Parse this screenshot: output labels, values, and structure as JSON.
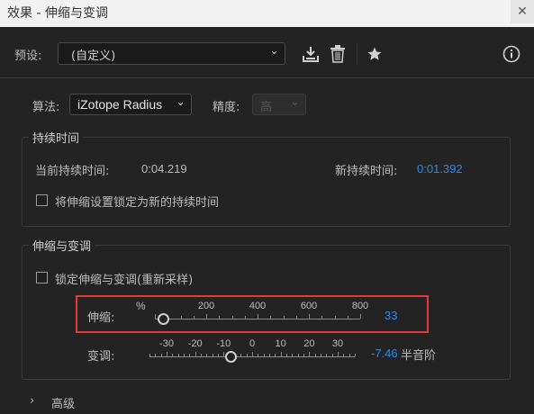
{
  "window": {
    "title": "效果 - 伸缩与变调",
    "close_icon": "close-icon"
  },
  "preset": {
    "label": "预设:",
    "value": "(自定义)"
  },
  "algorithm": {
    "label": "算法:",
    "value": "iZotope Radius",
    "precision_label": "精度:",
    "precision_value": "高"
  },
  "duration": {
    "legend": "持续时间",
    "current_label": "当前持续时间:",
    "current_value": "0:04.219",
    "new_label": "新持续时间:",
    "new_value": "0:01.392",
    "lock_label": "将伸缩设置锁定为新的持续时间"
  },
  "stretch_pitch": {
    "legend": "伸缩与变调",
    "lock_label": "锁定伸缩与变调(重新采样)",
    "stretch": {
      "label": "伸缩:",
      "unit": "%",
      "tick_labels": [
        "200",
        "400",
        "600",
        "800"
      ],
      "value": "33",
      "value_numeric": 33,
      "range": [
        0,
        800
      ]
    },
    "pitch": {
      "label": "变调:",
      "tick_labels": [
        "-30",
        "-20",
        "-10",
        "0",
        "10",
        "20",
        "30"
      ],
      "value": "-7.46",
      "unit": "半音阶",
      "value_numeric": -7.46,
      "range": [
        -36,
        36
      ]
    }
  },
  "advanced": {
    "label": "高级"
  },
  "colors": {
    "value_blue": "#2d8ceb",
    "highlight_red": "#e23a3a",
    "background": "#232323"
  }
}
